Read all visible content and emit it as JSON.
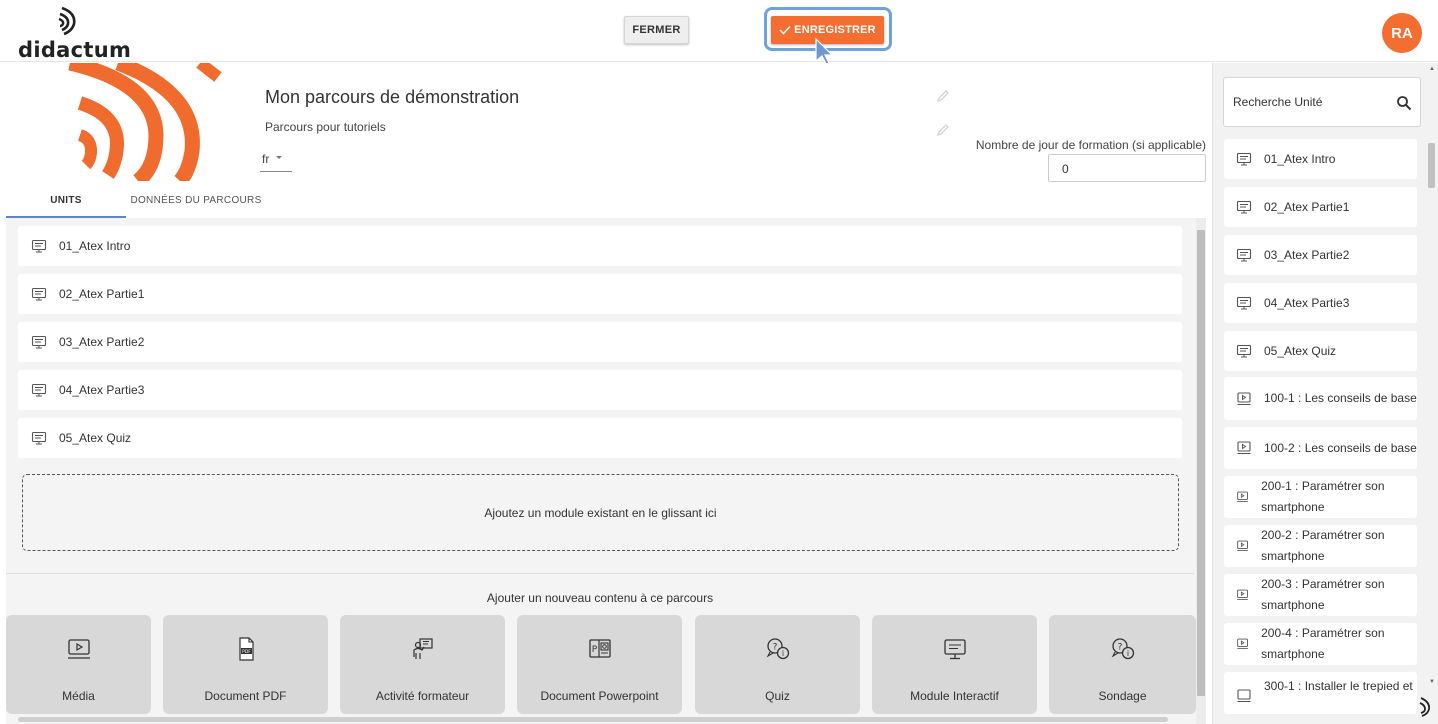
{
  "header": {
    "logo_text": "didactum",
    "close_label": "FERMER",
    "save_label": "ENREGISTRER",
    "avatar_initials": "RA",
    "accent_color": "#f36e30"
  },
  "course": {
    "title": "Mon parcours de démonstration",
    "subtitle": "Parcours pour tutoriels",
    "language": "fr",
    "days_label": "Nombre de jour de formation (si applicable)",
    "days_value": "0"
  },
  "tabs": [
    {
      "label": "UNITS",
      "active": true
    },
    {
      "label": "DONNÉES DU PARCOURS",
      "active": false
    }
  ],
  "units": [
    {
      "label": "01_Atex Intro",
      "icon": "interactive-module-icon"
    },
    {
      "label": "02_Atex Partie1",
      "icon": "interactive-module-icon"
    },
    {
      "label": "03_Atex Partie2",
      "icon": "interactive-module-icon"
    },
    {
      "label": "04_Atex Partie3",
      "icon": "interactive-module-icon"
    },
    {
      "label": "05_Atex Quiz",
      "icon": "interactive-module-icon"
    }
  ],
  "drop_zone_text": "Ajoutez un module existant en le glissant ici",
  "add_content": {
    "title": "Ajouter un nouveau contenu à ce parcours",
    "types": [
      {
        "label": "Média",
        "icon": "media-icon"
      },
      {
        "label": "Document PDF",
        "icon": "pdf-icon"
      },
      {
        "label": "Activité formateur",
        "icon": "trainer-activity-icon"
      },
      {
        "label": "Document Powerpoint",
        "icon": "powerpoint-icon"
      },
      {
        "label": "Quiz",
        "icon": "quiz-icon"
      },
      {
        "label": "Module Interactif",
        "icon": "interactive-module-icon"
      },
      {
        "label": "Sondage",
        "icon": "survey-icon"
      }
    ]
  },
  "sidebar": {
    "search_placeholder": "Recherche Unité",
    "items": [
      {
        "label": "01_Atex Intro",
        "icon": "interactive-module-icon"
      },
      {
        "label": "02_Atex Partie1",
        "icon": "interactive-module-icon"
      },
      {
        "label": "03_Atex Partie2",
        "icon": "interactive-module-icon"
      },
      {
        "label": "04_Atex Partie3",
        "icon": "interactive-module-icon"
      },
      {
        "label": "05_Atex Quiz",
        "icon": "interactive-module-icon"
      },
      {
        "label": "100-1 : Les conseils de base",
        "icon": "media-icon"
      },
      {
        "label": "100-2 : Les conseils de base",
        "icon": "media-icon"
      },
      {
        "label": "200-1 : Paramétrer son smartphone",
        "icon": "media-icon"
      },
      {
        "label": "200-2 : Paramétrer son smartphone",
        "icon": "media-icon"
      },
      {
        "label": "200-3 : Paramétrer son smartphone",
        "icon": "media-icon"
      },
      {
        "label": "200-4 : Paramétrer son smartphone",
        "icon": "media-icon"
      },
      {
        "label": "300-1 : Installer le trepied et",
        "icon": "media-icon"
      }
    ]
  }
}
